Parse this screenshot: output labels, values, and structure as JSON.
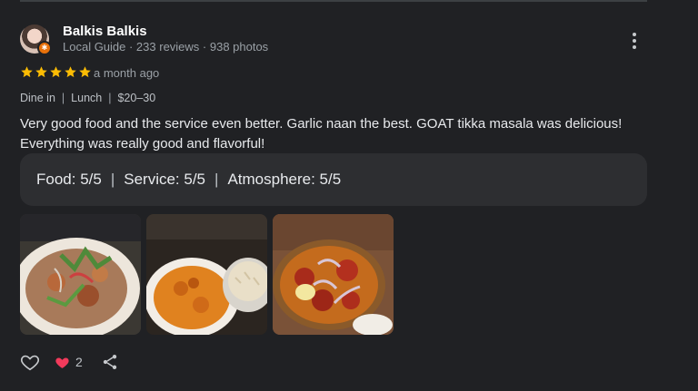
{
  "review": {
    "author_name": "Balkis Balkis",
    "author_meta": "Local Guide · 233 reviews · 938 photos",
    "rating": 5,
    "time_ago": "a month ago",
    "service_type": "Dine in",
    "meal_type": "Lunch",
    "price_range": "$20–30",
    "text_line1": "Very good food and the service even better. Garlic naan the best. GOAT tikka masala was delicious!",
    "text_line2": "Everything was really good and flavorful!",
    "ratings": {
      "food": "Food: 5/5",
      "service": "Service: 5/5",
      "atmosphere": "Atmosphere: 5/5"
    },
    "photos": [
      "food-photo",
      "curry-photo",
      "tandoori-photo"
    ],
    "like_count": "2"
  },
  "separators": {
    "pipe": "|"
  },
  "colors": {
    "background": "#202124",
    "card": "#2d2e31",
    "star": "#fbbc04",
    "heart_filled": "#f23a5b",
    "badge": "#e8710a"
  },
  "icons": {
    "more": "more-vert-icon",
    "like": "heart-outline-icon",
    "liked": "heart-filled-icon",
    "share": "share-icon",
    "guide_badge": "local-guide-badge-icon"
  }
}
